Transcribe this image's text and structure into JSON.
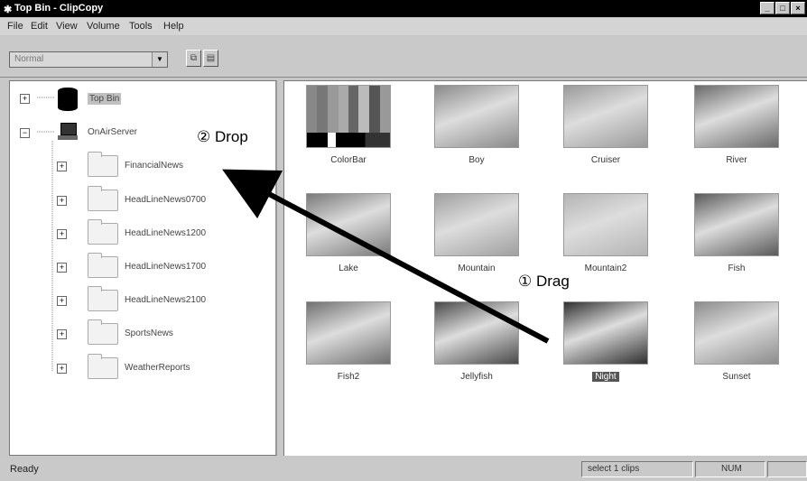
{
  "window": {
    "title": "Top Bin - ClipCopy",
    "buttons": {
      "minimize": "_",
      "maximize": "□",
      "close": "×"
    }
  },
  "menu": [
    "File",
    "Edit",
    "View",
    "Volume",
    "Tools",
    "Help"
  ],
  "toolbar": {
    "mode_value": "Normal",
    "copy_icon": "copy-icon",
    "paste_icon": "paste-icon"
  },
  "tree": {
    "top_bin": "Top Bin",
    "server": "OnAirServer",
    "folders": [
      "FinancialNews",
      "HeadLineNews0700",
      "HeadLineNews1200",
      "HeadLineNews1700",
      "HeadLineNews2100",
      "SportsNews",
      "WeatherReports"
    ]
  },
  "clips": [
    {
      "name": "ColorBar",
      "tone": "colorbar"
    },
    {
      "name": "Boy",
      "tone": "#8a8a8a"
    },
    {
      "name": "Cruiser",
      "tone": "#9a9a9a"
    },
    {
      "name": "River",
      "tone": "#6a6a6a"
    },
    {
      "name": "Lake",
      "tone": "#7a7a7a"
    },
    {
      "name": "Mountain",
      "tone": "#a0a0a0"
    },
    {
      "name": "Mountain2",
      "tone": "#b4b4b4"
    },
    {
      "name": "Fish",
      "tone": "#5a5a5a"
    },
    {
      "name": "Fish2",
      "tone": "#707070"
    },
    {
      "name": "Jellyfish",
      "tone": "#4a4a4a"
    },
    {
      "name": "Night",
      "tone": "#303030",
      "selected": true
    },
    {
      "name": "Sunset",
      "tone": "#8c8c8c"
    }
  ],
  "status": {
    "left": "Ready",
    "selection": "select 1 clips",
    "num": "NUM"
  },
  "annotations": {
    "drop": "② Drop",
    "drag": "① Drag"
  }
}
